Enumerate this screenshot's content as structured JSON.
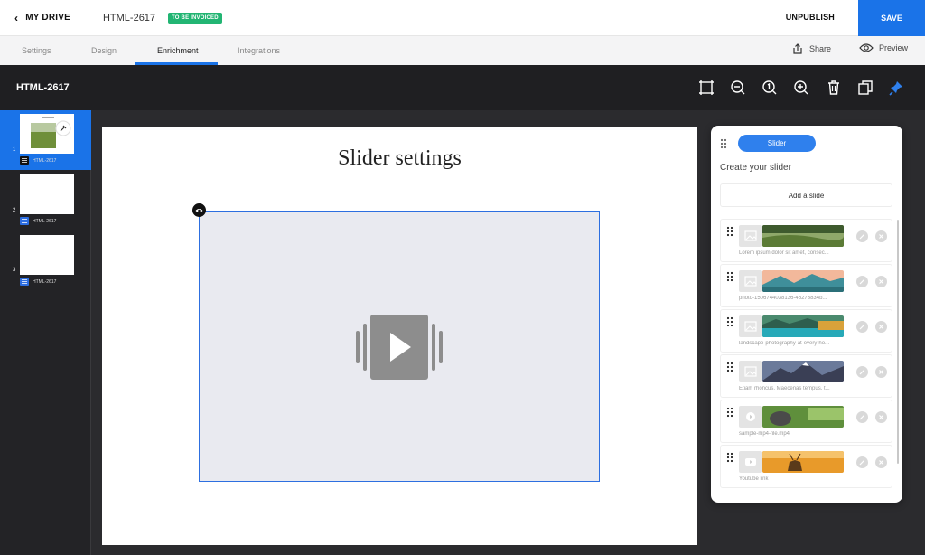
{
  "topbar": {
    "back_label": "MY DRIVE",
    "doc_title": "HTML-2617",
    "status_badge": "TO BE INVOICED",
    "unpublish_label": "UNPUBLISH",
    "save_label": "SAVE"
  },
  "tabs": [
    {
      "label": "Settings"
    },
    {
      "label": "Design"
    },
    {
      "label": "Enrichment"
    },
    {
      "label": "Integrations"
    }
  ],
  "tab_actions": {
    "share_label": "Share",
    "preview_label": "Preview"
  },
  "toolbar": {
    "title": "HTML-2617",
    "icons": [
      "crop-icon",
      "zoom-out-icon",
      "zoom-reset-icon",
      "zoom-in-icon",
      "trash-icon",
      "duplicate-icon",
      "pin-icon"
    ]
  },
  "slides": [
    {
      "number": "1",
      "label": "HTML-2617"
    },
    {
      "number": "2",
      "label": "HTML-2617"
    },
    {
      "number": "3",
      "label": "HTML-2617"
    }
  ],
  "canvas": {
    "title": "Slider settings"
  },
  "panel": {
    "pill_label": "Slider",
    "create_label": "Create your slider",
    "add_label": "Add a slide",
    "items": [
      {
        "caption": "Lorem ipsum dolor sit amet, consec..."
      },
      {
        "caption": "photo-1506744038136-46273834b..."
      },
      {
        "caption": "landscape-photography-at-every-ho..."
      },
      {
        "caption": "Etiam rhoncus. Maecenas tempus, t..."
      },
      {
        "caption": "sample-mp4-file.mp4"
      },
      {
        "caption": "Youtube link"
      }
    ]
  },
  "colors": {
    "accent": "#1a73e8",
    "badge": "#22b573",
    "dark_bg": "#1f1f22"
  }
}
